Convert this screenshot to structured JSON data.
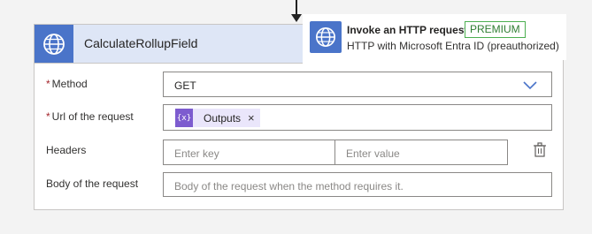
{
  "connector": {
    "title": "CalculateRollupField",
    "icon": "globe-icon"
  },
  "tooltip": {
    "title": "Invoke an HTTP request",
    "badge": "PREMIUM",
    "subtitle": "HTTP with Microsoft Entra ID (preauthorized)",
    "icon": "globe-icon"
  },
  "fields": {
    "method": {
      "label": "Method",
      "required": "*",
      "value": "GET"
    },
    "url": {
      "label": "Url of the request",
      "required": "*",
      "token_label": "Outputs",
      "token_icon": "{x}",
      "token_close": "×"
    },
    "headers": {
      "label": "Headers",
      "key_placeholder": "Enter key",
      "value_placeholder": "Enter value"
    },
    "body": {
      "label": "Body of the request",
      "placeholder": "Body of the request when the method requires it."
    }
  },
  "colors": {
    "accent": "#4a74c9",
    "header_bg": "#dee6f6",
    "token_bg": "#eae6fb",
    "token_icon_bg": "#7d5ccf",
    "premium": "#4caf50",
    "required": "#a4262c"
  }
}
